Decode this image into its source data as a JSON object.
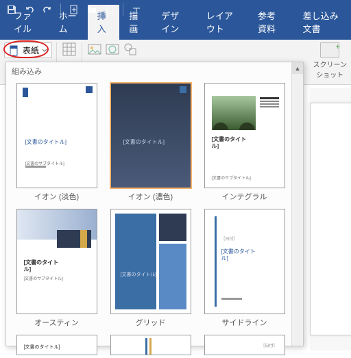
{
  "qat": {
    "save": "save",
    "undo": "undo",
    "redo": "redo",
    "new": "new",
    "open": "open",
    "blank": "blank"
  },
  "tabs": {
    "file": "ファイル",
    "home": "ホーム",
    "insert": "挿入",
    "draw": "描画",
    "design": "デザイン",
    "layout": "レイアウト",
    "references": "参考資料",
    "mailings": "差し込み文書"
  },
  "ribbon": {
    "cover_label": "表紙",
    "screenshot_label": "スクリーン",
    "screenshot_label2": "ショット"
  },
  "gallery": {
    "header": "組み込み",
    "doc_title": "[文書のタイトル]",
    "doc_title_break": "[文書のタイト",
    "doc_title_break2": "ル]",
    "doc_sub": "[文書のサブタイトル]",
    "items": [
      {
        "caption": "イオン (淡色)"
      },
      {
        "caption": "イオン (濃色)"
      },
      {
        "caption": "インテグラル"
      },
      {
        "caption": "オースティン"
      },
      {
        "caption": "グリッド"
      },
      {
        "caption": "サイドライン"
      }
    ]
  }
}
